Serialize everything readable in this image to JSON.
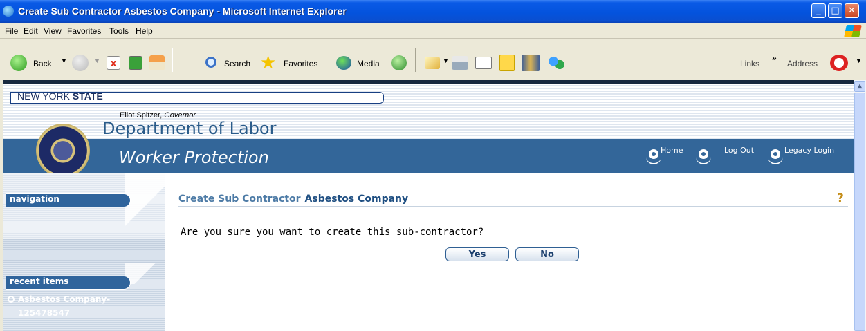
{
  "window": {
    "title": "Create Sub Contractor Asbestos Company - Microsoft Internet Explorer",
    "controls": {
      "minimize": "_",
      "maximize": "□",
      "close": "✕"
    }
  },
  "menu": [
    "File",
    "Edit",
    "View",
    "Favorites",
    "Tools",
    "Help"
  ],
  "toolbar": {
    "back": "Back",
    "search": "Search",
    "favorites": "Favorites",
    "media": "Media",
    "links": "Links",
    "chevron": "»",
    "address": "Address"
  },
  "banner": {
    "state_light": "NEW YORK",
    "state_bold": "STATE",
    "governor_name": "Eliot Spitzer,",
    "governor_title": "Governor",
    "department": "Department of Labor",
    "section": "Worker Protection",
    "links": {
      "home": "Home",
      "logout": "Log Out",
      "legacy": "Legacy Login"
    }
  },
  "sidebar": {
    "navigation_label": "navigation",
    "recent_label": "recent items",
    "recent_items": [
      {
        "line1": "Asbestos Company-",
        "line2": "125478547"
      }
    ]
  },
  "main": {
    "heading": "Create Sub Contractor",
    "heading_sub": "Asbestos Company",
    "help_icon": "?",
    "prompt": "Are you sure you want to create this sub-contractor?",
    "yes_label": "Yes",
    "no_label": "No"
  },
  "colors": {
    "accent": "#336699",
    "title_bar": "#0453dd",
    "heading": "#4d7ba6"
  }
}
